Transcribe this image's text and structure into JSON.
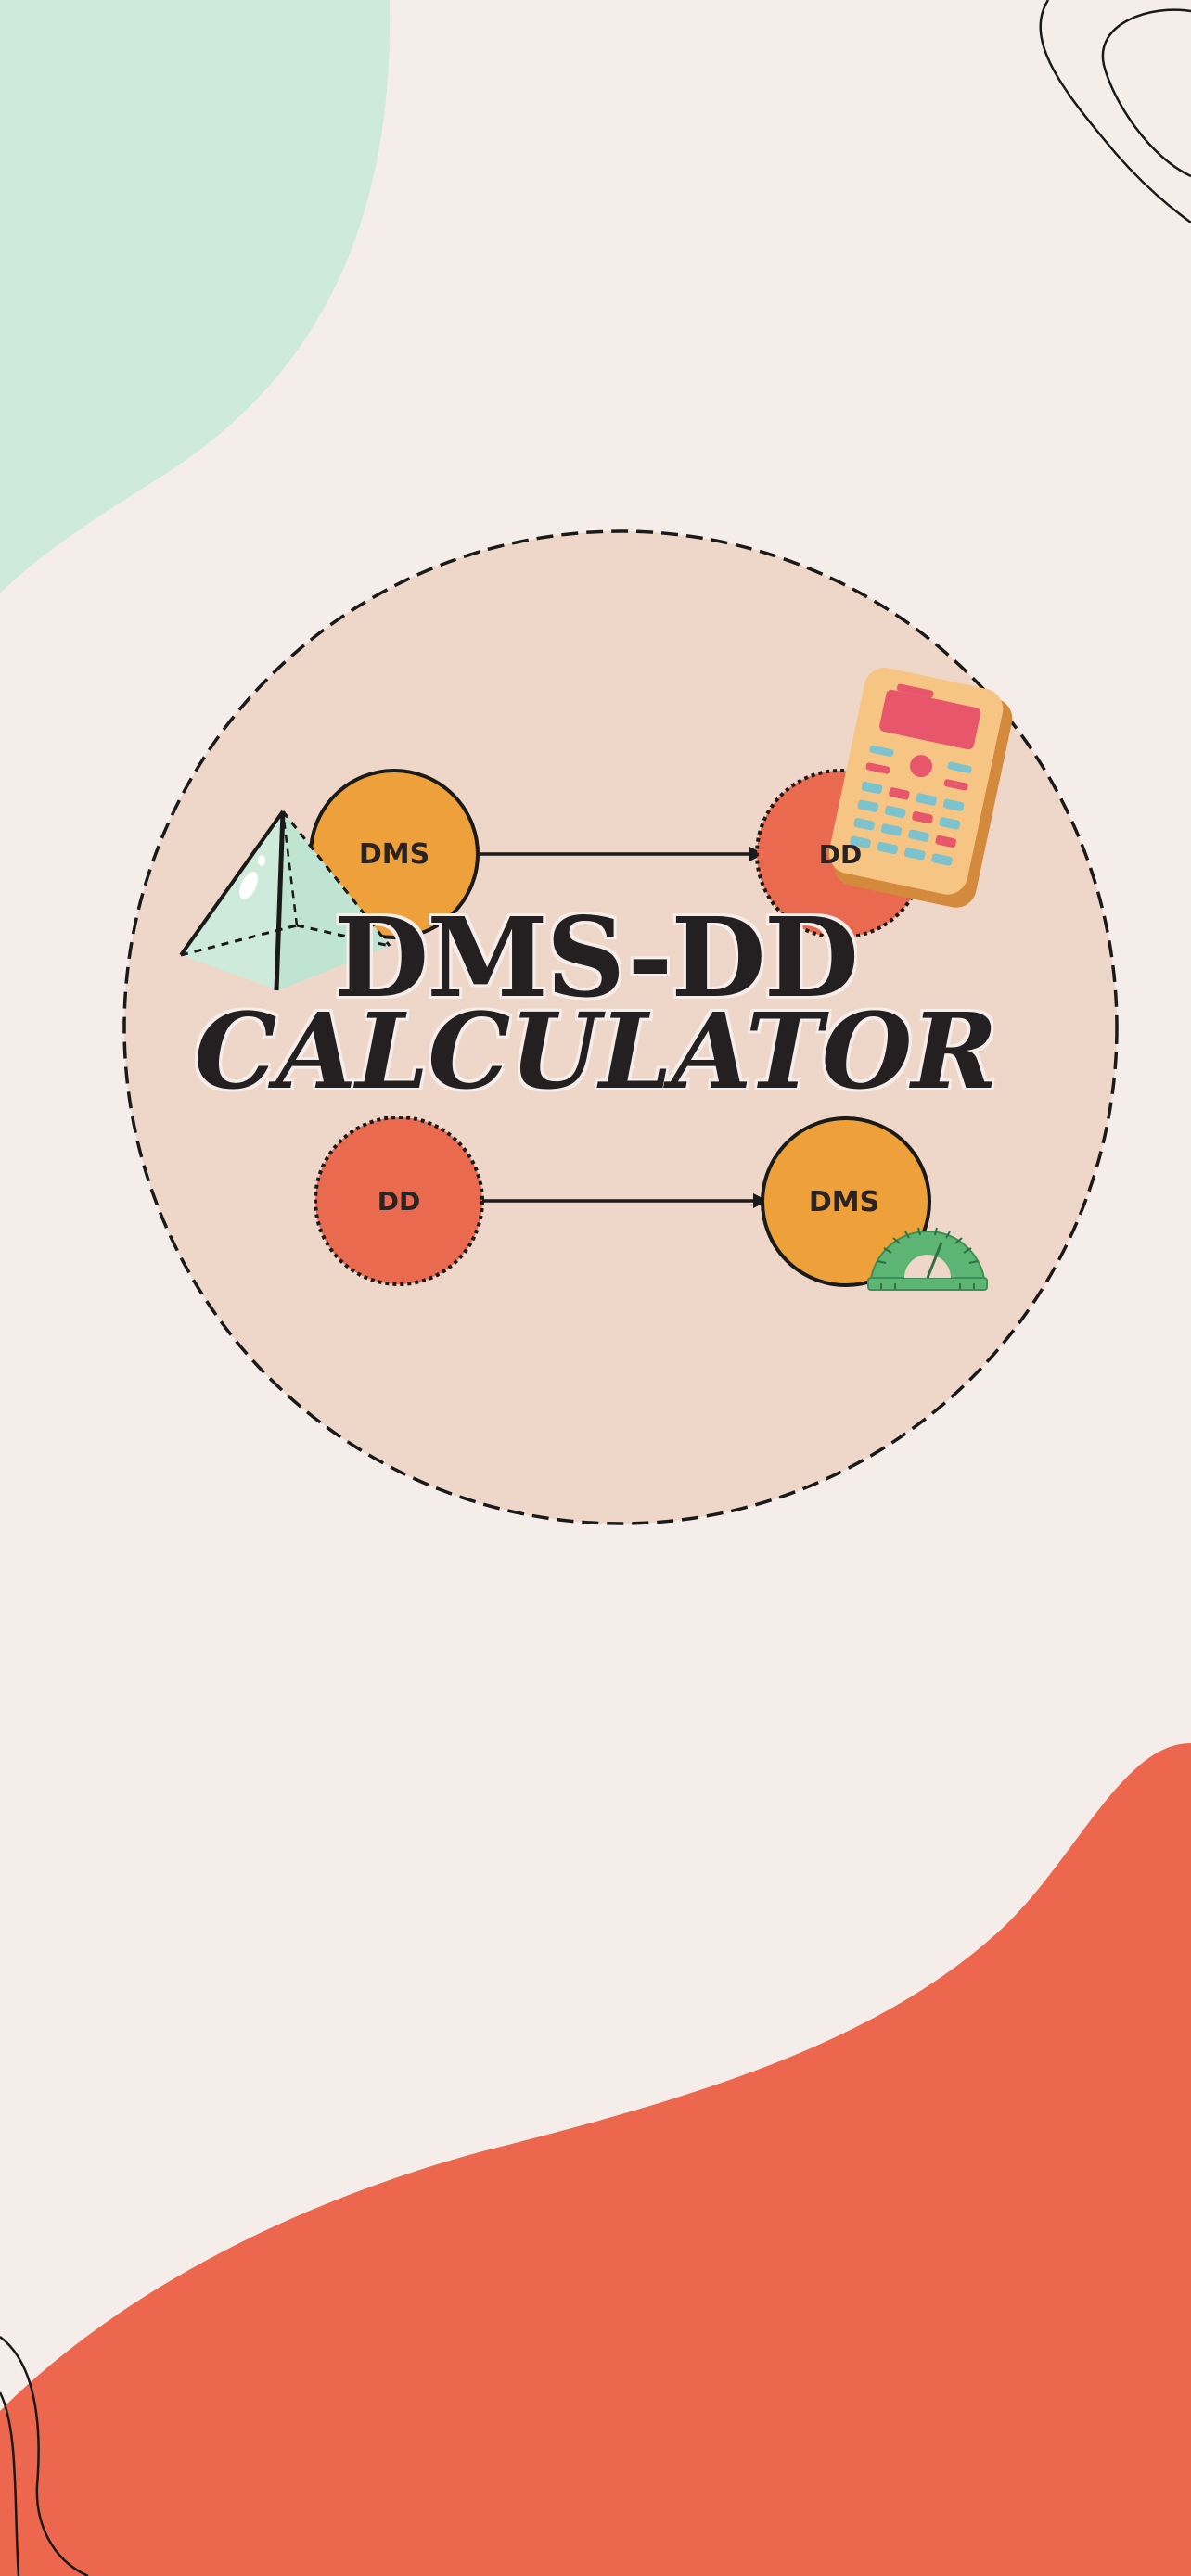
{
  "colors": {
    "background": "#f5ede9",
    "mint_blob": "#cdeadb",
    "coral_blob": "#ec674e",
    "circle_fill": "#eed7c8",
    "orange_bubble": "#eea13a",
    "red_bubble": "#e96a4f",
    "text_dark": "#241f20"
  },
  "title": {
    "line1": "DMS-DD",
    "line2": "CALCULATOR"
  },
  "diagram": {
    "top_row": {
      "from_label": "DMS",
      "to_label": "DD"
    },
    "bottom_row": {
      "from_label": "DD",
      "to_label": "DMS"
    }
  },
  "icons": {
    "pyramid": "pyramid-icon",
    "calculator": "calculator-icon",
    "protractor": "protractor-icon"
  }
}
